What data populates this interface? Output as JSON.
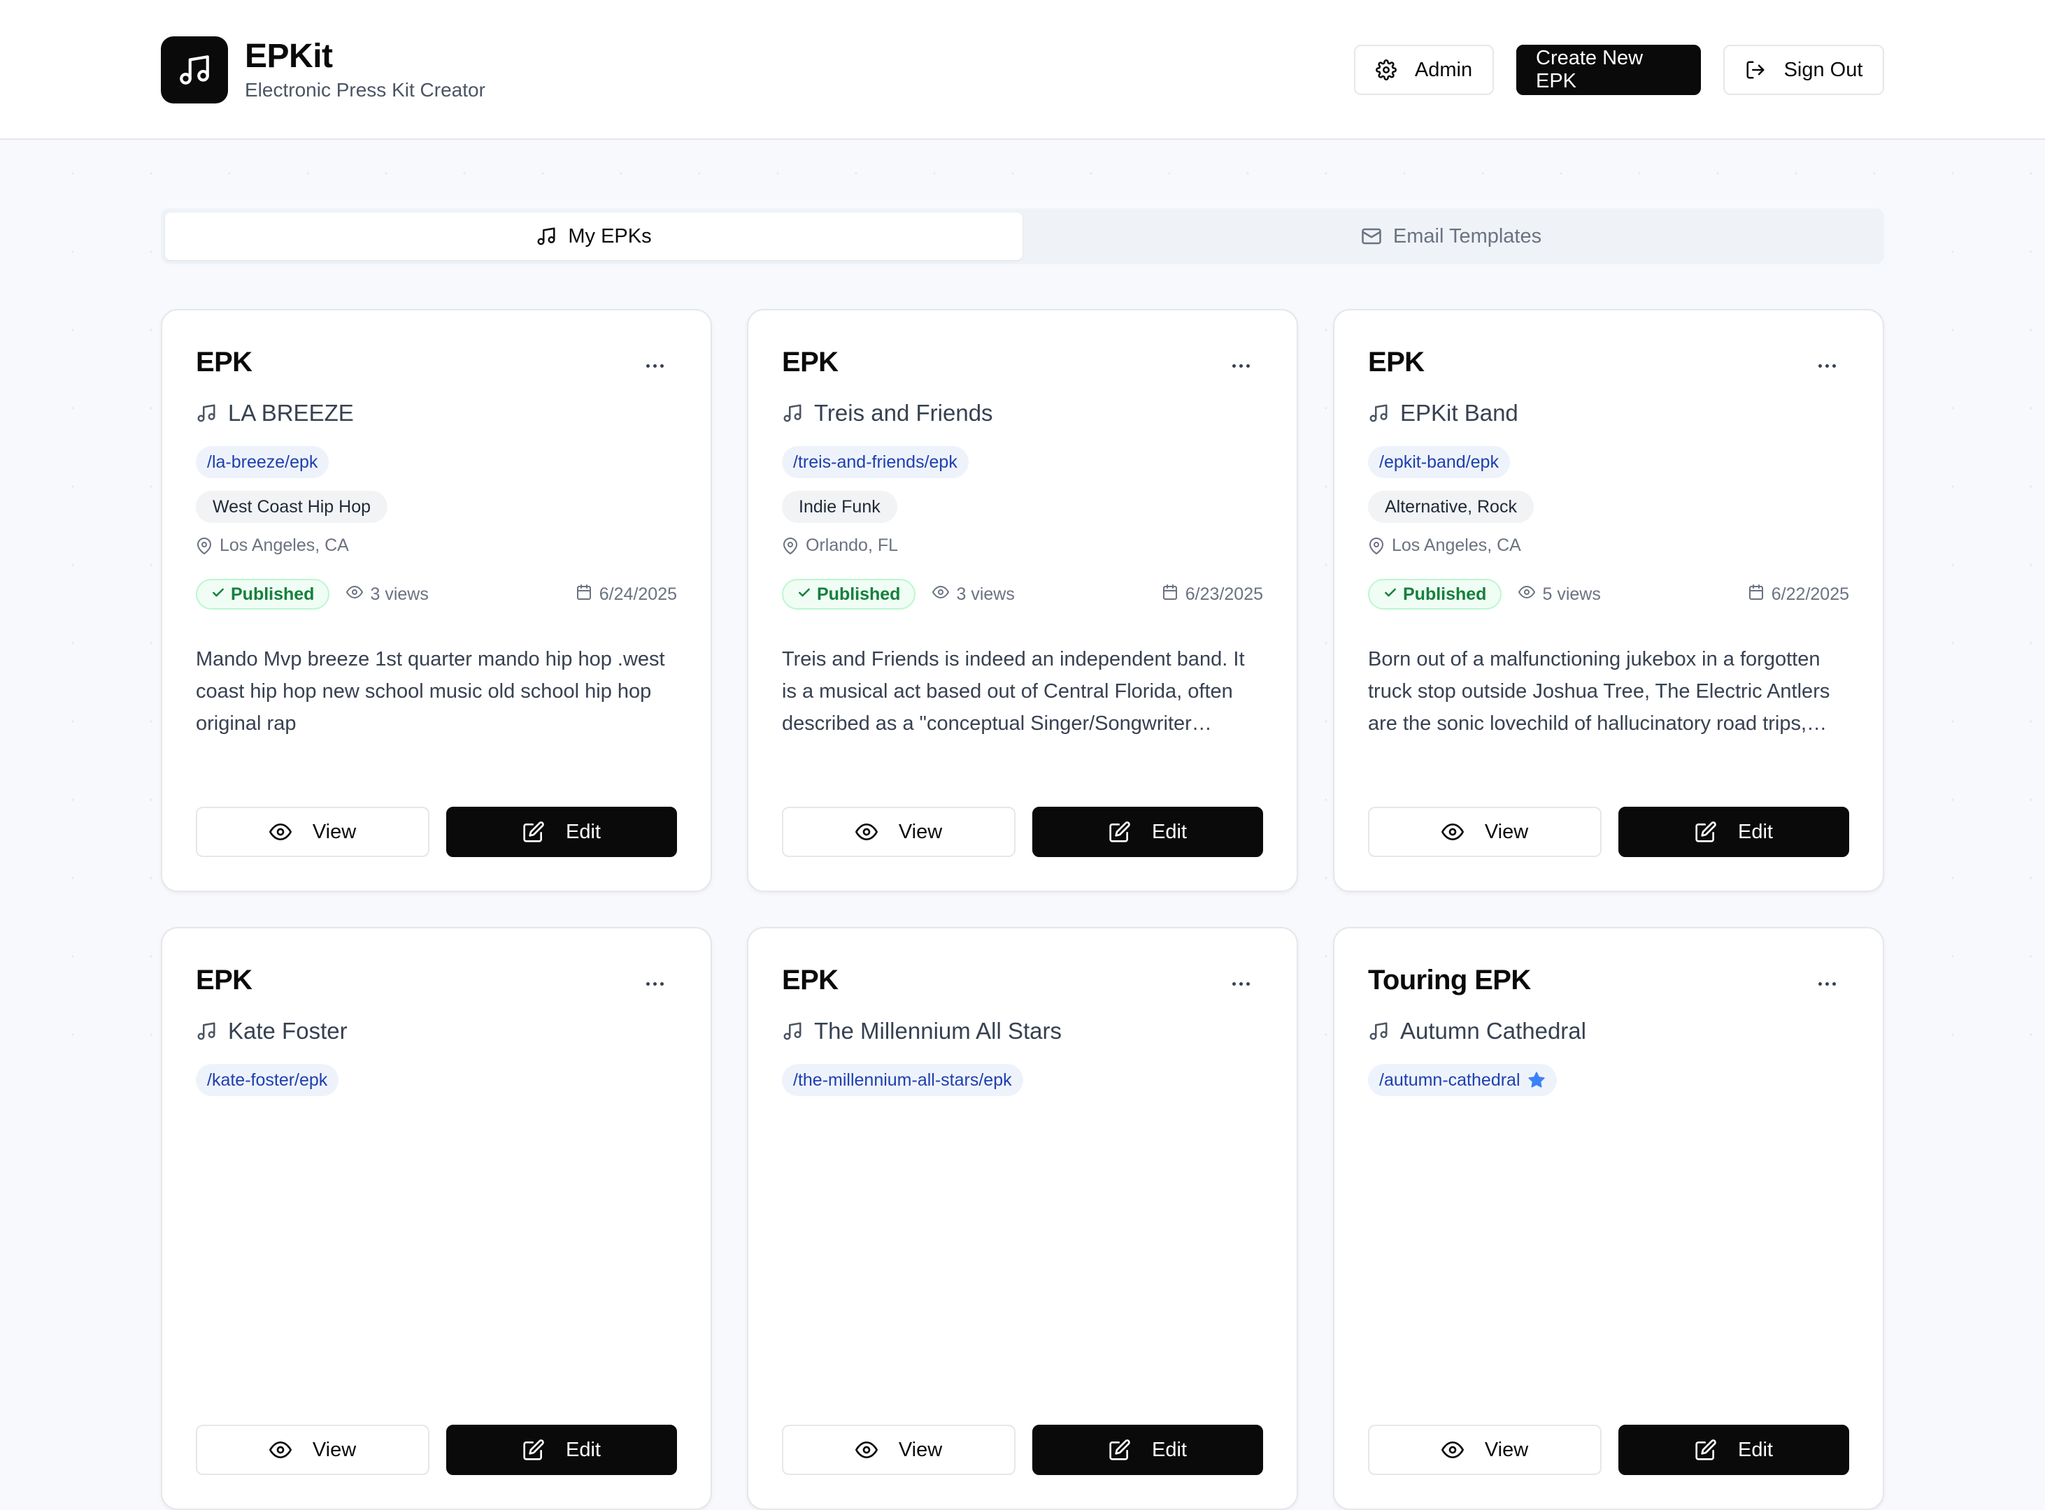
{
  "header": {
    "title": "EPKit",
    "subtitle": "Electronic Press Kit Creator",
    "admin_label": "Admin",
    "create_label": "Create New EPK",
    "signout_label": "Sign Out"
  },
  "tabs": [
    {
      "label": "My EPKs",
      "active": true,
      "icon": "music-note-icon"
    },
    {
      "label": "Email Templates",
      "active": false,
      "icon": "mail-icon"
    }
  ],
  "card_actions": {
    "view_label": "View",
    "edit_label": "Edit"
  },
  "colors": {
    "accent": "#0a0a0a",
    "published": "#15803d",
    "slug": "#1e40af",
    "star": "#3b82f6"
  },
  "cards": [
    {
      "type": "EPK",
      "artist": "LA BREEZE",
      "slug": "/la-breeze/epk",
      "featured": false,
      "genre": "West Coast Hip Hop",
      "location": "Los Angeles, CA",
      "status": "Published",
      "views": "3 views",
      "date": "6/24/2025",
      "description": "Mando Mvp breeze 1st quarter mando hip hop .west coast hip hop new school music old school hip hop original rap"
    },
    {
      "type": "EPK",
      "artist": "Treis and Friends",
      "slug": "/treis-and-friends/epk",
      "featured": false,
      "genre": "Indie Funk",
      "location": "Orlando, FL",
      "status": "Published",
      "views": "3 views",
      "date": "6/23/2025",
      "description": "Treis and Friends is indeed an independent band. It is a musical act based out of Central Florida, often described as a \"conceptual Singer/Songwriter collective\" blending many genres together."
    },
    {
      "type": "EPK",
      "artist": "EPKit Band",
      "slug": "/epkit-band/epk",
      "featured": false,
      "genre": "Alternative, Rock",
      "location": "Los Angeles, CA",
      "status": "Published",
      "views": "5 views",
      "date": "6/22/2025",
      "description": "Born out of a malfunctioning jukebox in a forgotten truck stop outside Joshua Tree, The Electric Antlers are the sonic lovechild of hallucinatory road trips, desert dust and vintage amplifiers."
    },
    {
      "type": "EPK",
      "artist": "Kate Foster",
      "slug": "/kate-foster/epk",
      "featured": false,
      "genre": "",
      "location": "",
      "status": "",
      "views": "",
      "date": "",
      "description": ""
    },
    {
      "type": "EPK",
      "artist": "The Millennium All Stars",
      "slug": "/the-millennium-all-stars/epk",
      "featured": false,
      "genre": "",
      "location": "",
      "status": "",
      "views": "",
      "date": "",
      "description": ""
    },
    {
      "type": "Touring EPK",
      "artist": "Autumn Cathedral",
      "slug": "/autumn-cathedral",
      "featured": true,
      "genre": "",
      "location": "",
      "status": "",
      "views": "",
      "date": "",
      "description": ""
    }
  ]
}
